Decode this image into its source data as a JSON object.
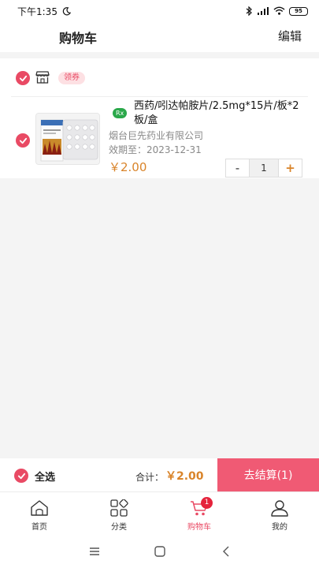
{
  "status_bar": {
    "time": "下午1:35",
    "battery": "95"
  },
  "header": {
    "title": "购物车",
    "edit_label": "编辑"
  },
  "shop": {
    "coupon_label": "领券"
  },
  "item": {
    "rx_badge": "Rx",
    "name": "西药/吲达帕胺片/2.5mg*15片/板*2板/盒",
    "manufacturer": "烟台巨先药业有限公司",
    "expiry": "效期至：2023-12-31",
    "price": "￥2.00",
    "quantity": "1",
    "minus_label": "-",
    "plus_label": "+"
  },
  "checkout": {
    "select_all_label": "全选",
    "total_label": "合计：",
    "total_value": "￥2.00",
    "button_label": "去结算(1)"
  },
  "tabbar": {
    "tabs": [
      {
        "label": "首页",
        "icon": "home-icon"
      },
      {
        "label": "分类",
        "icon": "category-icon"
      },
      {
        "label": "购物车",
        "icon": "cart-icon",
        "badge": "1",
        "active": true
      },
      {
        "label": "我的",
        "icon": "profile-icon"
      }
    ]
  },
  "colors": {
    "accent": "#e94a64",
    "price": "#d9842a",
    "checkout_button": "#f05a74",
    "rx": "#2aa84a"
  }
}
